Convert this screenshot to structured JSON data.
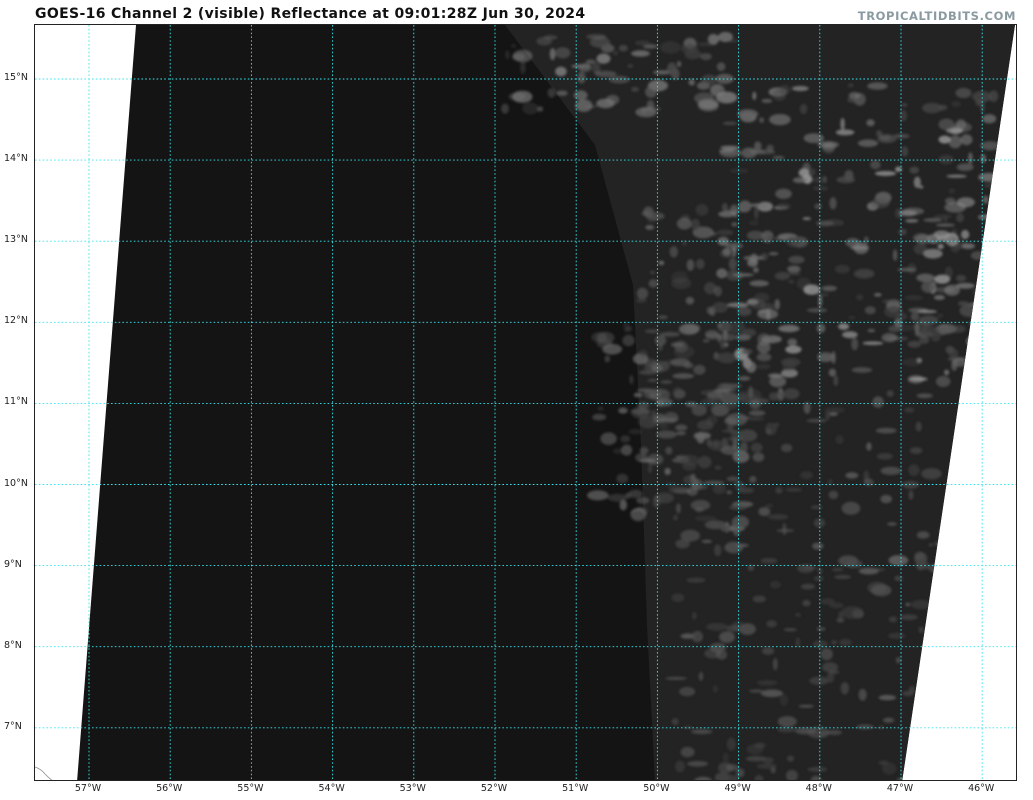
{
  "header": {
    "title": "GOES-16 Channel 2 (visible) Reflectance at 09:01:28Z Jun 30, 2024",
    "credit": "TROPICALTIDBITS.COM"
  },
  "map": {
    "product": "visible reflectance",
    "gridline_color": "#35e6ee",
    "scene_color": "#151515",
    "no_data_color": "#ffffff",
    "latitudes": [
      {
        "value": 15,
        "label": "15°N"
      },
      {
        "value": 14,
        "label": "14°N"
      },
      {
        "value": 13,
        "label": "13°N"
      },
      {
        "value": 12,
        "label": "12°N"
      },
      {
        "value": 11,
        "label": "11°N"
      },
      {
        "value": 10,
        "label": "10°N"
      },
      {
        "value": 9,
        "label": "9°N"
      },
      {
        "value": 8,
        "label": "8°N"
      },
      {
        "value": 7,
        "label": "7°N"
      }
    ],
    "longitudes": [
      {
        "value": -57,
        "label": "57°W"
      },
      {
        "value": -56,
        "label": "56°W"
      },
      {
        "value": -55,
        "label": "55°W"
      },
      {
        "value": -54,
        "label": "54°W"
      },
      {
        "value": -53,
        "label": "53°W"
      },
      {
        "value": -52,
        "label": "52°W"
      },
      {
        "value": -51,
        "label": "51°W"
      },
      {
        "value": -50,
        "label": "50°W"
      },
      {
        "value": -49,
        "label": "49°W"
      },
      {
        "value": -48,
        "label": "48°W"
      },
      {
        "value": -47,
        "label": "47°W"
      },
      {
        "value": -46,
        "label": "46°W"
      }
    ]
  }
}
